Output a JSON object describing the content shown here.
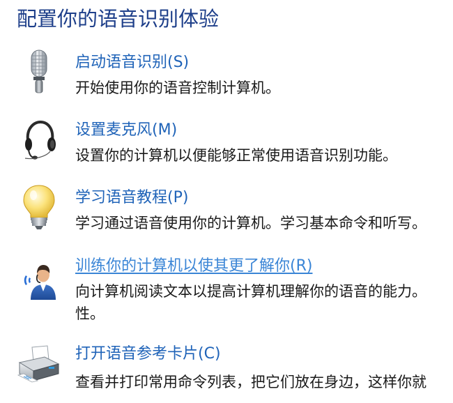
{
  "header": {
    "title": "配置你的语音识别体验"
  },
  "tasks": [
    {
      "link": "启动语音识别(S)",
      "description": "开始使用你的语音控制计算机。",
      "icon": "microphone-icon"
    },
    {
      "link": "设置麦克风(M)",
      "description": "设置你的计算机以便能够正常使用语音识别功能。",
      "icon": "headset-icon"
    },
    {
      "link": "学习语音教程(P)",
      "description": "学习通过语音使用你的计算机。学习基本命令和听写。",
      "icon": "lightbulb-icon"
    },
    {
      "link": "训练你的计算机以使其更了解你(R)",
      "description_line1": "向计算机阅读文本以提高计算机理解你的语音的能力。",
      "description_line2": "性。",
      "icon": "user-speaking-icon"
    },
    {
      "link": "打开语音参考卡片(C)",
      "description": "查看并打印常用命令列表，把它们放在身边，这样你就",
      "icon": "printer-icon"
    }
  ]
}
